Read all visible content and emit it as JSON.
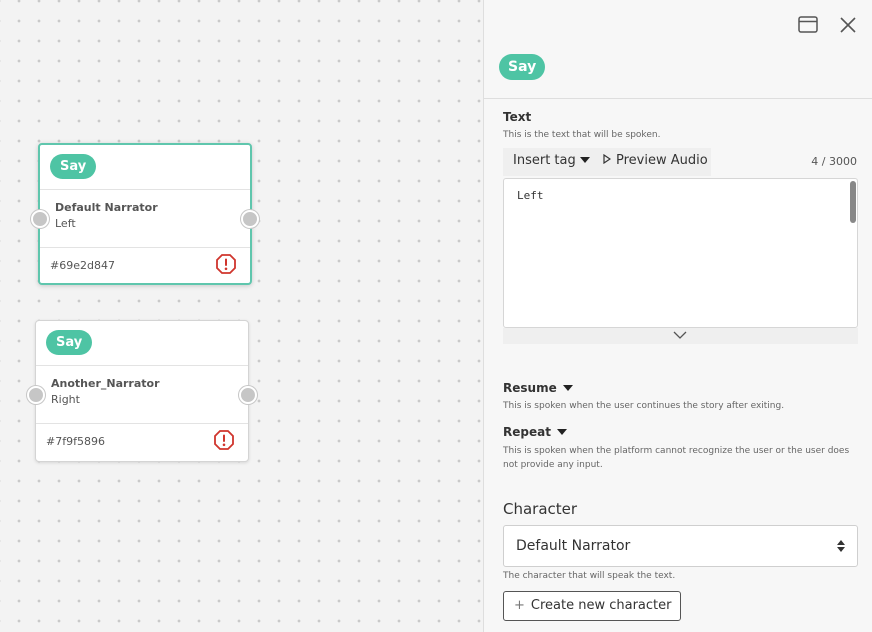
{
  "canvas": {
    "nodes": [
      {
        "type_label": "Say",
        "character": "Default Narrator",
        "position": "Left",
        "id": "#69e2d847",
        "selected": true
      },
      {
        "type_label": "Say",
        "character": "Another_Narrator",
        "position": "Right",
        "id": "#7f9f5896",
        "selected": false
      }
    ]
  },
  "panel": {
    "type_label": "Say",
    "icons": {
      "window": "window-icon",
      "close": "close-icon"
    },
    "text_section": {
      "label": "Text",
      "hint": "This is the text that will be spoken.",
      "insert_tag_label": "Insert tag",
      "preview_audio_label": "Preview Audio",
      "counter": "4 / 3000",
      "value": "Left"
    },
    "resume": {
      "label": "Resume",
      "hint": "This is spoken when the user continues the story after exiting."
    },
    "repeat": {
      "label": "Repeat",
      "hint": "This is spoken when the platform cannot recognize the user or the user does not provide any input."
    },
    "character": {
      "label": "Character",
      "selected": "Default Narrator",
      "hint": "The character that will speak the text.",
      "create_label": "Create new character"
    }
  },
  "colors": {
    "accent": "#4ec4a4",
    "warning": "#d0352d",
    "selected_border": "#5fc6ad"
  }
}
